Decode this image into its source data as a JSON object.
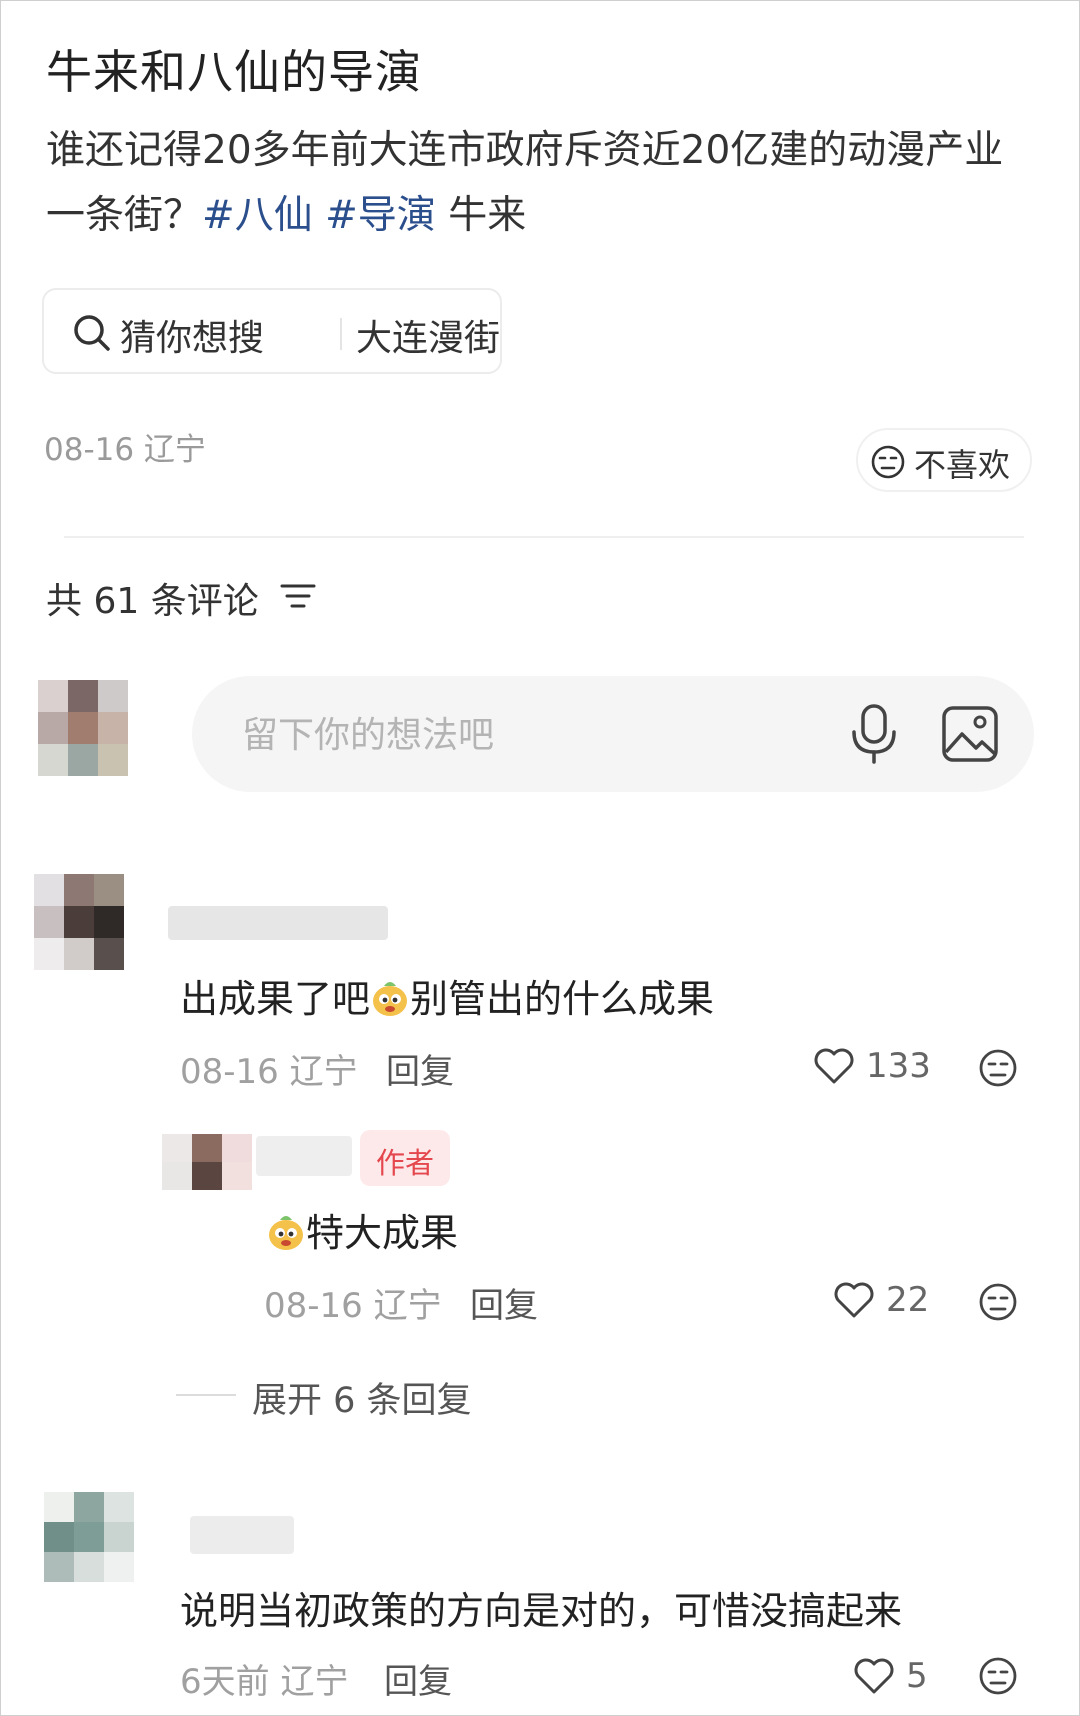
{
  "post": {
    "title": "牛来和八仙的导演",
    "body_text": "谁还记得20多年前大连市政府斥资近20亿建的动漫产业一条街？",
    "tags": [
      "#八仙",
      "#导演"
    ],
    "trailing_text": "牛来",
    "search_chip": {
      "label": "猜你想搜",
      "query": "大连漫街",
      "icon": "search-icon"
    },
    "date_location": "08-16 辽宁",
    "dislike_label": "不喜欢"
  },
  "comments_header": {
    "count_label": "共 61 条评论",
    "sort_icon": "sort-icon"
  },
  "composer": {
    "placeholder": "留下你的想法吧",
    "mic_icon": "mic-icon",
    "image_icon": "image-icon"
  },
  "comments": [
    {
      "text_before": "出成果了吧",
      "emoji": "cartoon-face-emoji",
      "text_after": "别管出的什么成果",
      "meta": "08-16 辽宁",
      "reply_label": "回复",
      "likes": "133",
      "replies": [
        {
          "badge": "作者",
          "emoji": "cartoon-face-emoji",
          "text": "特大成果",
          "meta": "08-16 辽宁",
          "reply_label": "回复",
          "likes": "22"
        }
      ],
      "expand_label": "展开 6 条回复"
    },
    {
      "text": "说明当初政策的方向是对的，可惜没搞起来",
      "meta": "6天前 辽宁",
      "reply_label": "回复",
      "likes": "5"
    }
  ],
  "colors": {
    "tag": "#2b4f8c",
    "author_badge_text": "#e4474d",
    "author_badge_bg": "#fde9ea",
    "meta": "#a0a0a0"
  }
}
